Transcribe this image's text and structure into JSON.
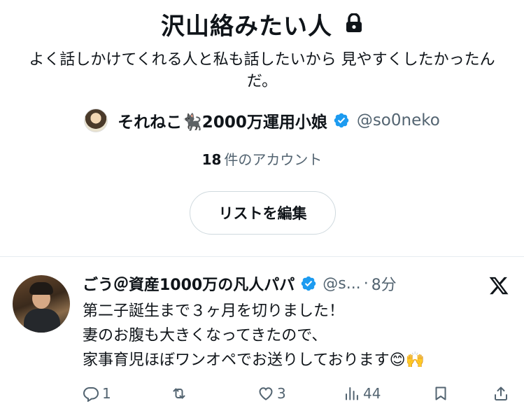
{
  "list": {
    "title": "沢山絡みたい人",
    "description": "よく話しかけてくれる人と私も話したいから 見やすくしたかったんだ。",
    "owner": {
      "name": "それねこ🐈‍⬛2000万運用小娘",
      "handle": "@so0neko"
    },
    "member_count": "18",
    "member_count_label": "件のアカウント",
    "edit_button_label": "リストを編集"
  },
  "tweet": {
    "name": "ごう＠資産1000万の凡人パパ",
    "handle": "@s...",
    "separator": "·",
    "time": "8分",
    "text": "第二子誕生まで３ヶ月を切りました！\n妻のお腹も大きくなってきたので、\n家事育児ほぼワンオペでお送りしております😊🙌",
    "actions": {
      "replies": "1",
      "retweets": "",
      "likes": "3",
      "views": "44"
    }
  },
  "colors": {
    "text": "#0f1419",
    "secondary": "#536471",
    "verified": "#1d9bf0",
    "border": "#cfd9de"
  }
}
